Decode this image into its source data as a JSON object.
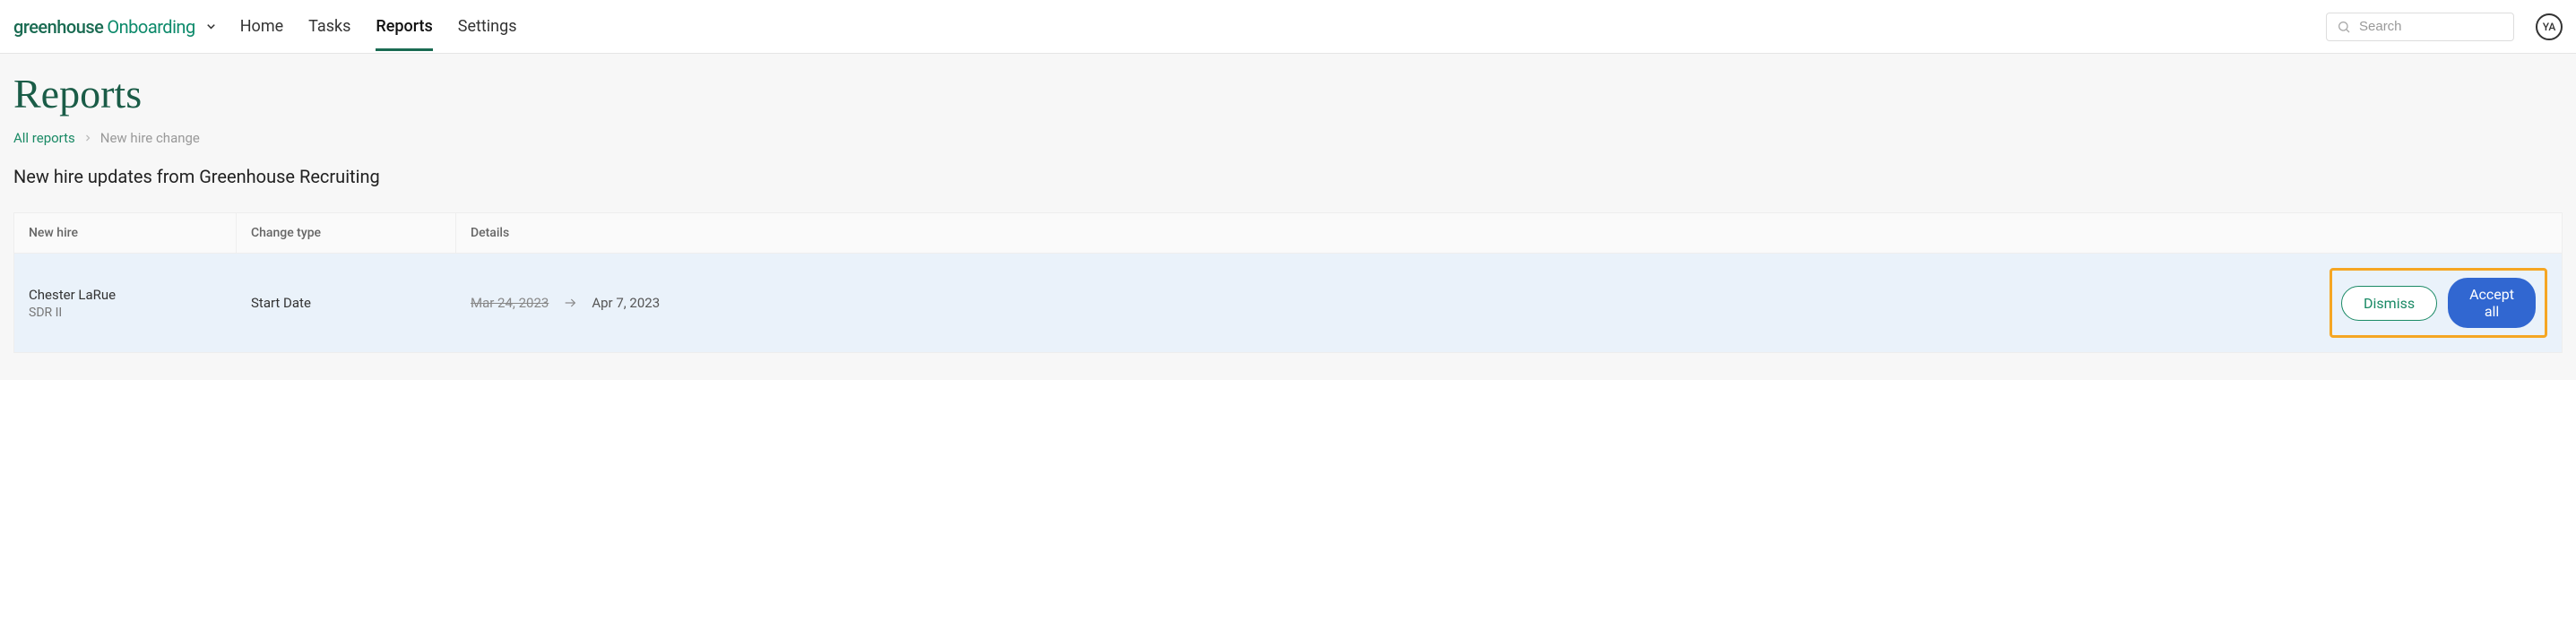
{
  "header": {
    "logo_primary": "greenhouse",
    "logo_secondary": "Onboarding",
    "nav": [
      {
        "label": "Home",
        "active": false
      },
      {
        "label": "Tasks",
        "active": false
      },
      {
        "label": "Reports",
        "active": true
      },
      {
        "label": "Settings",
        "active": false
      }
    ],
    "search_placeholder": "Search",
    "avatar_initials": "YA"
  },
  "page": {
    "title": "Reports",
    "breadcrumb": {
      "link": "All reports",
      "current": "New hire change"
    },
    "section_title": "New hire updates from Greenhouse Recruiting"
  },
  "table": {
    "headers": {
      "new_hire": "New hire",
      "change_type": "Change type",
      "details": "Details"
    },
    "rows": [
      {
        "name": "Chester LaRue",
        "role": "SDR II",
        "change_type": "Start Date",
        "old_value": "Mar 24, 2023",
        "new_value": "Apr 7, 2023"
      }
    ],
    "actions": {
      "dismiss": "Dismiss",
      "accept_all": "Accept all"
    }
  }
}
